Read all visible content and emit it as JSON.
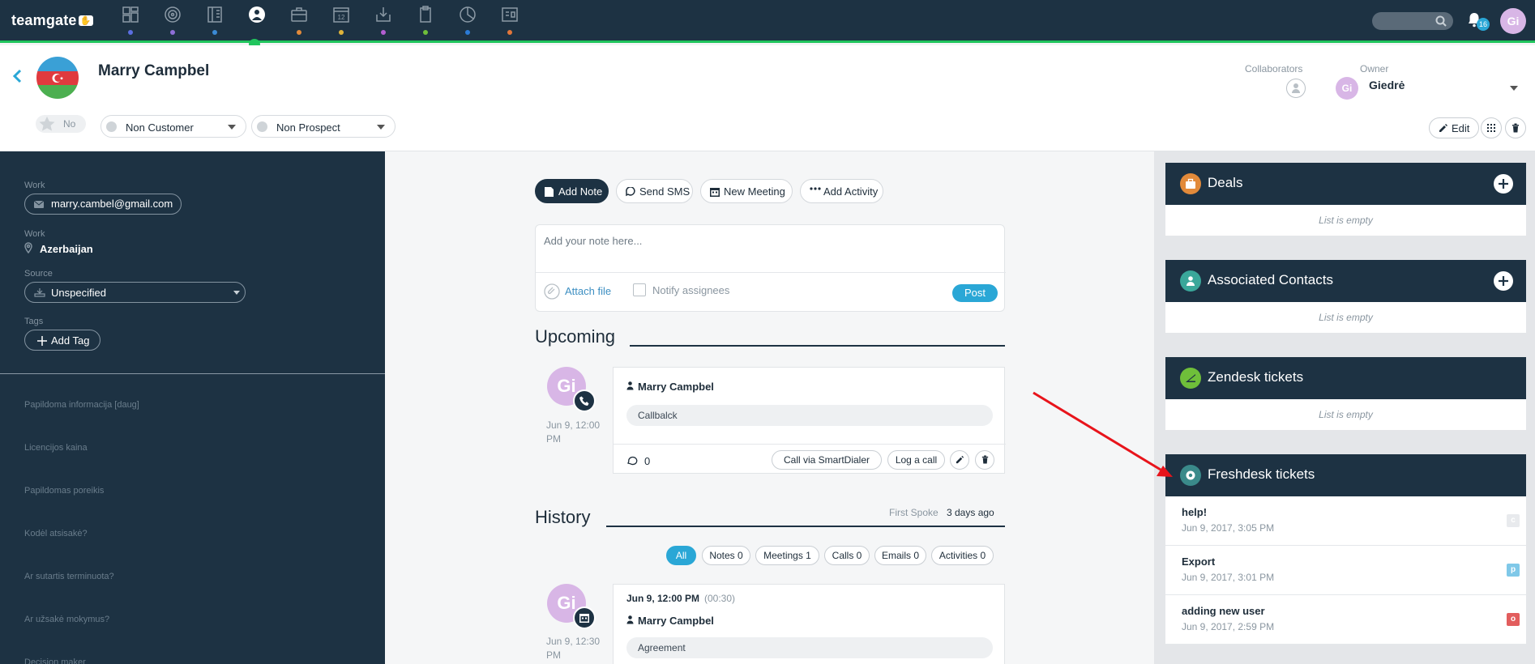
{
  "app": {
    "logo": "teamgate",
    "notifications_count": "16",
    "user_initials": "Gi",
    "nav_icons": [
      "dashboard-icon",
      "target-icon",
      "library-icon",
      "contacts-icon",
      "briefcase-icon",
      "calendar-icon",
      "inbox-icon",
      "clipboard-icon",
      "chart-pie-icon",
      "reports-icon"
    ],
    "nav_calendar_day": "12",
    "nav_dot_colors": [
      "#5b6ee1",
      "#8e6fd8",
      "#3b8bd6",
      "#21c55d",
      "#e28a3a",
      "#e0b43a",
      "#b35ed2",
      "#6fbf3a",
      "#2b7bd6",
      "#e2763a"
    ]
  },
  "contact": {
    "name": "Marry Campbel",
    "favorite_label": "No",
    "customer_status": "Non Customer",
    "prospect_status": "Non Prospect",
    "collaborators_label": "Collaborators",
    "owner_label": "Owner",
    "owner_initials": "Gi",
    "owner_name": "Giedrė",
    "edit_label": "Edit"
  },
  "sidebar": {
    "email_label": "Work",
    "email": "marry.cambel@gmail.com",
    "address_label": "Work",
    "address": "Azerbaijan",
    "source_label": "Source",
    "source_value": "Unspecified",
    "tags_label": "Tags",
    "add_tag_label": "Add Tag",
    "custom_fields": [
      "Papildoma informacija [daug]",
      "Licencijos kaina",
      "Papildomas poreikis",
      "Kodėl atsisakė?",
      "Ar sutartis terminuota?",
      "Ar užsakė mokymus?",
      "Decision maker"
    ]
  },
  "composer": {
    "actions": [
      "Add Note",
      "Send SMS",
      "New Meeting",
      "Add Activity"
    ],
    "placeholder": "Add your note here...",
    "attach_label": "Attach file",
    "notify_label": "Notify assignees",
    "post_label": "Post"
  },
  "upcoming": {
    "title": "Upcoming",
    "item": {
      "initials": "Gi",
      "date": "Jun 9, 12:00 PM",
      "person": "Marry Campbel",
      "subject": "Callbalck",
      "comments": "0",
      "smartdialer_label": "Call via SmartDialer",
      "log_call_label": "Log a call"
    }
  },
  "history": {
    "title": "History",
    "first_spoke_label": "First Spoke",
    "first_spoke_value": "3 days ago",
    "filters": [
      "All",
      "Notes 0",
      "Meetings 1",
      "Calls 0",
      "Emails 0",
      "Activities 0"
    ],
    "item": {
      "initials": "Gi",
      "date": "Jun 9, 12:30 PM",
      "when": "Jun 9, 12:00 PM",
      "duration": "(00:30)",
      "person": "Marry Campbel",
      "subject": "Agreement"
    }
  },
  "widgets": {
    "empty_label": "List is empty",
    "deals_title": "Deals",
    "contacts_title": "Associated Contacts",
    "zendesk_title": "Zendesk tickets",
    "freshdesk_title": "Freshdesk tickets",
    "deals_color": "#e28a3a",
    "contacts_color": "#3aa79a",
    "zendesk_color": "#6fbf3a",
    "freshdesk_color": "#3a8a8a",
    "tickets": [
      {
        "title": "help!",
        "date": "Jun 9, 2017, 3:05 PM",
        "status": "c",
        "color": "#e8eaed"
      },
      {
        "title": "Export",
        "date": "Jun 9, 2017, 3:01 PM",
        "status": "p",
        "color": "#7fc8e8"
      },
      {
        "title": "adding new user",
        "date": "Jun 9, 2017, 2:59 PM",
        "status": "o",
        "color": "#e25d5d"
      }
    ]
  },
  "annotation": {
    "arrow_color": "#e8141b"
  }
}
